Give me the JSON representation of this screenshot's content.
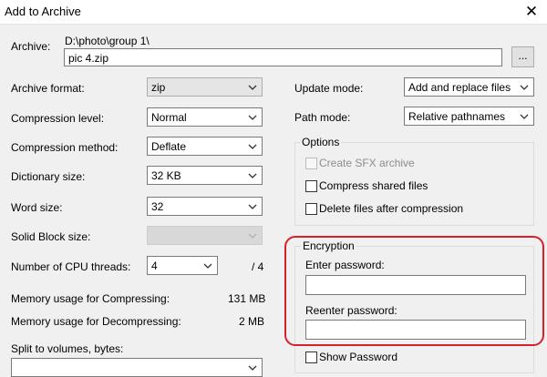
{
  "window": {
    "title": "Add to Archive",
    "close_glyph": "✕"
  },
  "archive": {
    "label": "Archive:",
    "path": "D:\\photo\\group 1\\",
    "name": "pic 4.zip",
    "browse_label": "..."
  },
  "left": {
    "archive_format": {
      "label": "Archive format:",
      "value": "zip"
    },
    "compression_level": {
      "label": "Compression level:",
      "value": "Normal"
    },
    "compression_method": {
      "label": "Compression method:",
      "value": "Deflate"
    },
    "dictionary_size": {
      "label": "Dictionary size:",
      "value": "32 KB"
    },
    "word_size": {
      "label": "Word size:",
      "value": "32"
    },
    "solid_block_size": {
      "label": "Solid Block size:",
      "value": ""
    },
    "cpu_threads": {
      "label": "Number of CPU threads:",
      "value": "4",
      "max": "/ 4"
    },
    "memory_compressing": {
      "label": "Memory usage for Compressing:",
      "value": "131 MB"
    },
    "memory_decompressing": {
      "label": "Memory usage for Decompressing:",
      "value": "2 MB"
    },
    "split_volumes": {
      "label": "Split to volumes, bytes:",
      "value": ""
    }
  },
  "right": {
    "update_mode": {
      "label": "Update mode:",
      "value": "Add and replace files"
    },
    "path_mode": {
      "label": "Path mode:",
      "value": "Relative pathnames"
    },
    "options": {
      "title": "Options",
      "create_sfx": "Create SFX archive",
      "compress_shared": "Compress shared files",
      "delete_after": "Delete files after compression"
    },
    "encryption": {
      "title": "Encryption",
      "enter_password_label": "Enter password:",
      "enter_password_value": "",
      "reenter_password_label": "Reenter password:",
      "reenter_password_value": "",
      "show_password": "Show Password"
    }
  },
  "colors": {
    "highlight": "#d6202a",
    "background": "#f0f0f0"
  },
  "icons": {
    "dropdown": "chevron-down-icon",
    "close": "close-icon"
  }
}
